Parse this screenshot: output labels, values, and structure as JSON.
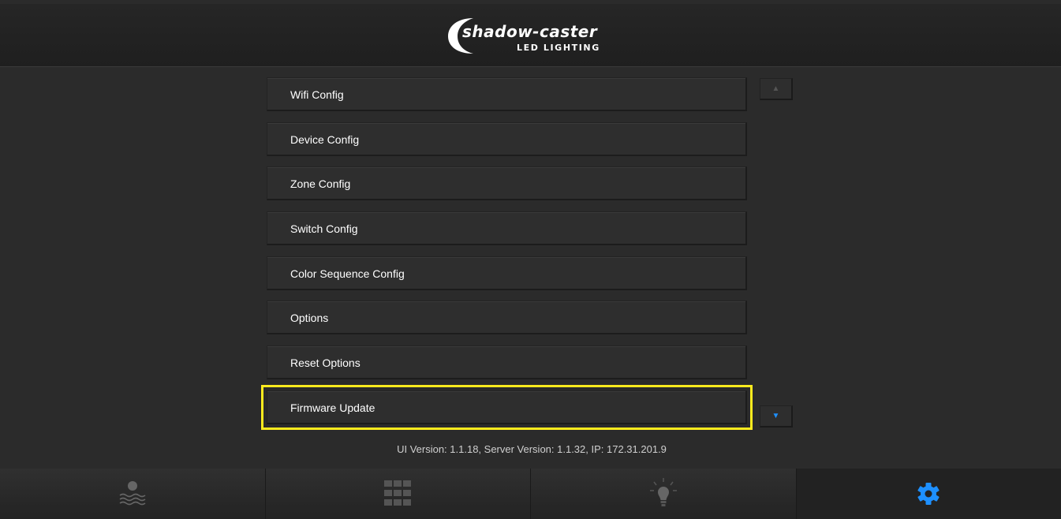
{
  "header": {
    "logo_brand": "shadow-caster",
    "logo_sub": "LED LIGHTING"
  },
  "menu": {
    "items": [
      {
        "label": "Wifi Config"
      },
      {
        "label": "Device Config"
      },
      {
        "label": "Zone Config"
      },
      {
        "label": "Switch Config"
      },
      {
        "label": "Color Sequence Config"
      },
      {
        "label": "Options"
      },
      {
        "label": "Reset Options"
      },
      {
        "label": "Firmware Update",
        "selected": true
      }
    ]
  },
  "scroll": {
    "up_icon": "triangle-up-icon",
    "down_icon": "triangle-down-icon",
    "up_glyph": "▲",
    "down_glyph": "▼"
  },
  "footer": {
    "version_text": "UI Version: 1.1.18, Server Version: 1.1.32, IP: 172.31.201.9"
  },
  "bottom_nav": {
    "tabs": [
      {
        "icon": "sun-over-water-icon",
        "active": false
      },
      {
        "icon": "grid-icon",
        "active": false
      },
      {
        "icon": "light-bulb-icon",
        "active": false
      },
      {
        "icon": "gear-icon",
        "active": true
      }
    ]
  },
  "colors": {
    "highlight": "#ffeb1e",
    "accent": "#1e90ff",
    "background": "#2b2b2b"
  }
}
